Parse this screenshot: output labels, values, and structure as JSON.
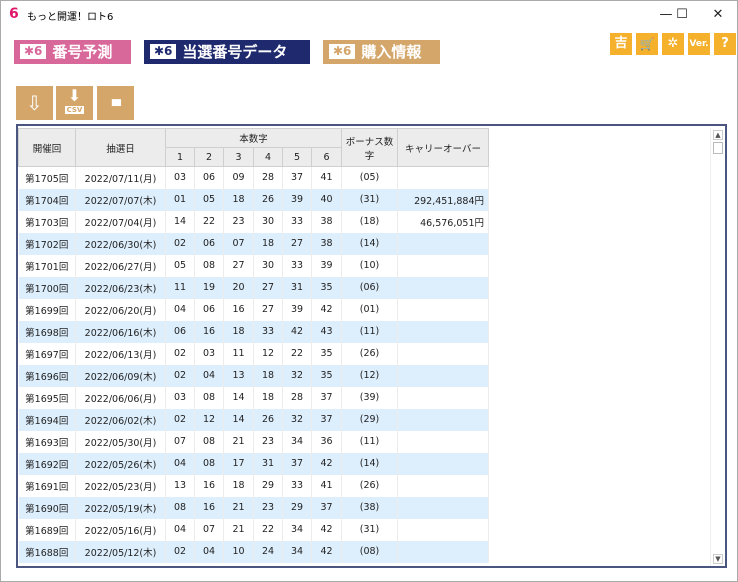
{
  "window": {
    "title": "もっと開運！ロト6",
    "app_icon": "6",
    "minimize": "—",
    "maximize": "☐",
    "close": "✕"
  },
  "nav": {
    "badge": "✱6",
    "tabs": [
      {
        "label": "番号予測",
        "color": "#d9689a"
      },
      {
        "label": "当選番号データ",
        "color": "#1f2a6e"
      },
      {
        "label": "購入情報",
        "color": "#d4a66a"
      }
    ]
  },
  "top_icons": [
    {
      "name": "fortune",
      "glyph": "吉"
    },
    {
      "name": "cart",
      "glyph": "🛒"
    },
    {
      "name": "settings",
      "glyph": "✲"
    },
    {
      "name": "version",
      "glyph": "Ver."
    },
    {
      "name": "help",
      "glyph": "?"
    }
  ],
  "tools": [
    {
      "name": "download-file",
      "glyph": "⇩"
    },
    {
      "name": "csv-export",
      "glyph": "⬇",
      "sub": "CSV"
    },
    {
      "name": "chart",
      "glyph": "▮▮▮"
    }
  ],
  "table": {
    "headers": {
      "round": "開催回",
      "date": "抽選日",
      "main": "本数字",
      "nums": [
        "1",
        "2",
        "3",
        "4",
        "5",
        "6"
      ],
      "bonus": "ボーナス数字",
      "carry": "キャリーオーバー"
    },
    "rows": [
      {
        "round": "第1705回",
        "date": "2022/07/11(月)",
        "n": [
          "03",
          "06",
          "09",
          "28",
          "37",
          "41"
        ],
        "bonus": "(05)",
        "carry": ""
      },
      {
        "round": "第1704回",
        "date": "2022/07/07(木)",
        "n": [
          "01",
          "05",
          "18",
          "26",
          "39",
          "40"
        ],
        "bonus": "(31)",
        "carry": "292,451,884円"
      },
      {
        "round": "第1703回",
        "date": "2022/07/04(月)",
        "n": [
          "14",
          "22",
          "23",
          "30",
          "33",
          "38"
        ],
        "bonus": "(18)",
        "carry": "46,576,051円"
      },
      {
        "round": "第1702回",
        "date": "2022/06/30(木)",
        "n": [
          "02",
          "06",
          "07",
          "18",
          "27",
          "38"
        ],
        "bonus": "(14)",
        "carry": ""
      },
      {
        "round": "第1701回",
        "date": "2022/06/27(月)",
        "n": [
          "05",
          "08",
          "27",
          "30",
          "33",
          "39"
        ],
        "bonus": "(10)",
        "carry": ""
      },
      {
        "round": "第1700回",
        "date": "2022/06/23(木)",
        "n": [
          "11",
          "19",
          "20",
          "27",
          "31",
          "35"
        ],
        "bonus": "(06)",
        "carry": ""
      },
      {
        "round": "第1699回",
        "date": "2022/06/20(月)",
        "n": [
          "04",
          "06",
          "16",
          "27",
          "39",
          "42"
        ],
        "bonus": "(01)",
        "carry": ""
      },
      {
        "round": "第1698回",
        "date": "2022/06/16(木)",
        "n": [
          "06",
          "16",
          "18",
          "33",
          "42",
          "43"
        ],
        "bonus": "(11)",
        "carry": ""
      },
      {
        "round": "第1697回",
        "date": "2022/06/13(月)",
        "n": [
          "02",
          "03",
          "11",
          "12",
          "22",
          "35"
        ],
        "bonus": "(26)",
        "carry": ""
      },
      {
        "round": "第1696回",
        "date": "2022/06/09(木)",
        "n": [
          "02",
          "04",
          "13",
          "18",
          "32",
          "35"
        ],
        "bonus": "(12)",
        "carry": ""
      },
      {
        "round": "第1695回",
        "date": "2022/06/06(月)",
        "n": [
          "03",
          "08",
          "14",
          "18",
          "28",
          "37"
        ],
        "bonus": "(39)",
        "carry": ""
      },
      {
        "round": "第1694回",
        "date": "2022/06/02(木)",
        "n": [
          "02",
          "12",
          "14",
          "26",
          "32",
          "37"
        ],
        "bonus": "(29)",
        "carry": ""
      },
      {
        "round": "第1693回",
        "date": "2022/05/30(月)",
        "n": [
          "07",
          "08",
          "21",
          "23",
          "34",
          "36"
        ],
        "bonus": "(11)",
        "carry": ""
      },
      {
        "round": "第1692回",
        "date": "2022/05/26(木)",
        "n": [
          "04",
          "08",
          "17",
          "31",
          "37",
          "42"
        ],
        "bonus": "(14)",
        "carry": ""
      },
      {
        "round": "第1691回",
        "date": "2022/05/23(月)",
        "n": [
          "13",
          "16",
          "18",
          "29",
          "33",
          "41"
        ],
        "bonus": "(26)",
        "carry": ""
      },
      {
        "round": "第1690回",
        "date": "2022/05/19(木)",
        "n": [
          "08",
          "16",
          "21",
          "23",
          "29",
          "37"
        ],
        "bonus": "(38)",
        "carry": ""
      },
      {
        "round": "第1689回",
        "date": "2022/05/16(月)",
        "n": [
          "04",
          "07",
          "21",
          "22",
          "34",
          "42"
        ],
        "bonus": "(31)",
        "carry": ""
      },
      {
        "round": "第1688回",
        "date": "2022/05/12(木)",
        "n": [
          "02",
          "04",
          "10",
          "24",
          "34",
          "42"
        ],
        "bonus": "(08)",
        "carry": ""
      }
    ]
  }
}
